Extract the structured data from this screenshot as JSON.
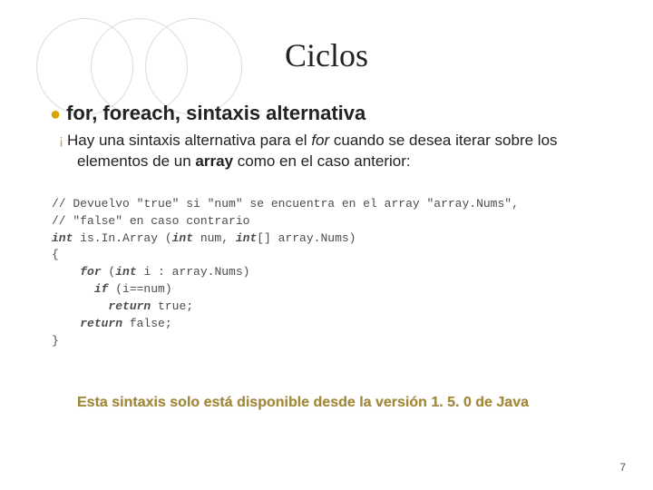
{
  "title": "Ciclos",
  "heading": "for, foreach, sintaxis alternativa",
  "para_pre": "Hay una sintaxis alternativa para el ",
  "para_kw": "for",
  "para_mid": " cuando se desea iterar sobre los elementos de un ",
  "para_kw2": "array",
  "para_post": " como en el caso anterior:",
  "code": {
    "c1_a": "// Devuelvo \"true\" si \"num\" se encuentra en el array \"array.Nums\",",
    "c2_a": "// \"false\" en caso contrario",
    "c3_kw1": "int",
    "c3_mid1": " is.In.Array (",
    "c3_kw2": "int",
    "c3_mid2": " num, ",
    "c3_kw3": "int",
    "c3_mid3": "[] array.Nums)",
    "c4": "{",
    "c5_pre": "    ",
    "c5_kw1": "for",
    "c5_mid1": " (",
    "c5_kw2": "int",
    "c5_mid2": " i : array.Nums)",
    "c6_pre": "      ",
    "c6_kw": "if",
    "c6_rest": " (i==num)",
    "c7_pre": "        ",
    "c7_kw": "return",
    "c7_rest": " true;",
    "c8_pre": "    ",
    "c8_kw": "return",
    "c8_rest": " false;",
    "c9": "}"
  },
  "footer": "Esta sintaxis solo está disponible desde la versión 1. 5. 0 de Java",
  "page": "7"
}
